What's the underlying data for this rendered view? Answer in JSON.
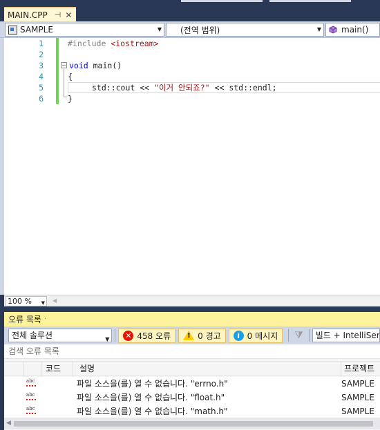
{
  "tab": {
    "title": "MAIN.CPP",
    "pin_glyph": "⊣",
    "close_glyph": "✕"
  },
  "navbar": {
    "project": "SAMPLE",
    "scope": "(전역 범위)",
    "member": "main()"
  },
  "editor": {
    "line_numbers": [
      "1",
      "2",
      "3",
      "4",
      "5",
      "6"
    ],
    "lines": {
      "l1_directive": "#include",
      "l1_header": "<iostream>",
      "l3_keyword": "void",
      "l3_rest": " main()",
      "l4": "{",
      "l5_pre": "std::cout << ",
      "l5_string": "\"이거 안되죠?\"",
      "l5_post": " << std::endl;",
      "l6": "}"
    }
  },
  "zoom": {
    "value": "100 %"
  },
  "error_list": {
    "title": "오류 목록",
    "scope": "전체 솔루션",
    "errors_label": "458 오류",
    "warnings_label": "0 경고",
    "messages_label": "0 메시지",
    "build_filter": "빌드 + IntelliSense",
    "search_placeholder": "검색 오류 목록",
    "columns": {
      "code": "코드",
      "description": "설명",
      "project": "프로젝트"
    },
    "rows": [
      {
        "description": "파일 소스을(를) 열 수 없습니다. \"errno.h\"",
        "project": "SAMPLE"
      },
      {
        "description": "파일 소스을(를) 열 수 없습니다. \"float.h\"",
        "project": "SAMPLE"
      },
      {
        "description": "파일 소스을(를) 열 수 없습니다. \"math.h\"",
        "project": "SAMPLE"
      }
    ],
    "row_icon_text": "abc"
  },
  "colors": {
    "chrome": "#293955",
    "active_tab": "#fff7d6",
    "toolwindow_title": "#fff29d",
    "error_red": "#e51400",
    "warning_yellow": "#ffcc00",
    "info_blue": "#1ba1e2",
    "change_bar_green": "#6fd453"
  },
  "icons": [
    "project-icon",
    "cube-icon",
    "error-icon",
    "warning-icon",
    "info-icon",
    "filter-icon",
    "spelling-error-icon"
  ]
}
